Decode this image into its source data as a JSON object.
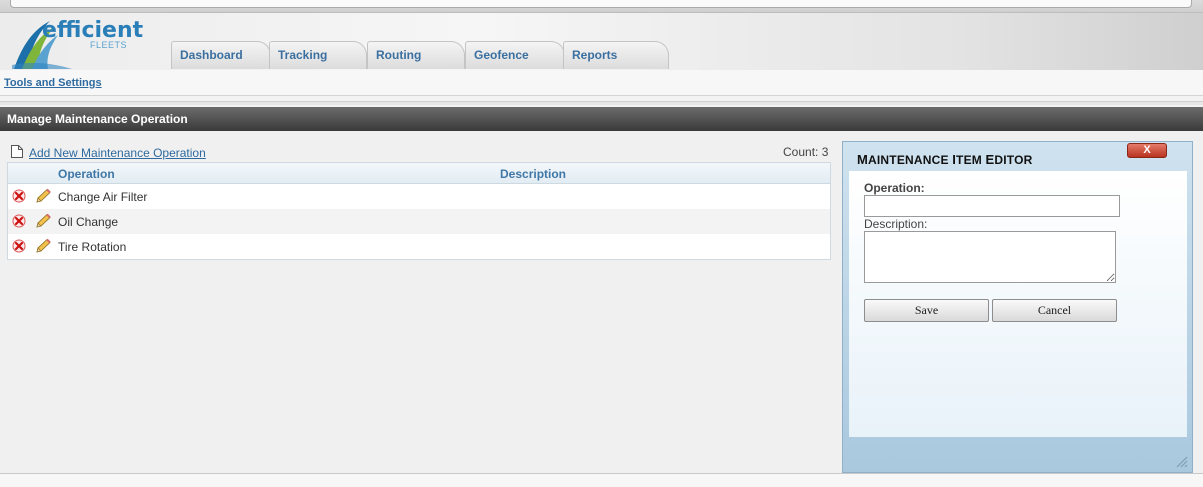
{
  "brand": {
    "name": "efficient",
    "sub": "FLEETS"
  },
  "tabs": [
    {
      "label": "Dashboard"
    },
    {
      "label": "Tracking"
    },
    {
      "label": "Routing"
    },
    {
      "label": "Geofence"
    },
    {
      "label": "Reports"
    }
  ],
  "nav": {
    "tools_link": "Tools and Settings"
  },
  "section": {
    "title": "Manage Maintenance Operation"
  },
  "list": {
    "add_link": "Add New Maintenance Operation",
    "count": "Count: 3",
    "columns": {
      "operation": "Operation",
      "description": "Description"
    },
    "rows": [
      {
        "operation": "Change Air Filter",
        "description": ""
      },
      {
        "operation": "Oil Change",
        "description": ""
      },
      {
        "operation": "Tire Rotation",
        "description": ""
      }
    ]
  },
  "editor": {
    "title_first": "M",
    "title_rest1": "AINTENANCE ",
    "title_i": "I",
    "title_rest2": "TEM ",
    "title_e": "E",
    "title_rest3": "DITOR",
    "close": "X",
    "operation_label": "Operation:",
    "operation_value": "",
    "description_label": "Description:",
    "description_value": "",
    "save_label": "Save",
    "cancel_label": "Cancel"
  },
  "colors": {
    "accent": "#2e6aa0",
    "header_bar": "#3a3a3a",
    "editor_bg": "#cfe2ef",
    "close_button": "#b8341f"
  },
  "icons": {
    "delete": "delete-icon",
    "edit": "pencil-icon",
    "add": "document-icon"
  }
}
